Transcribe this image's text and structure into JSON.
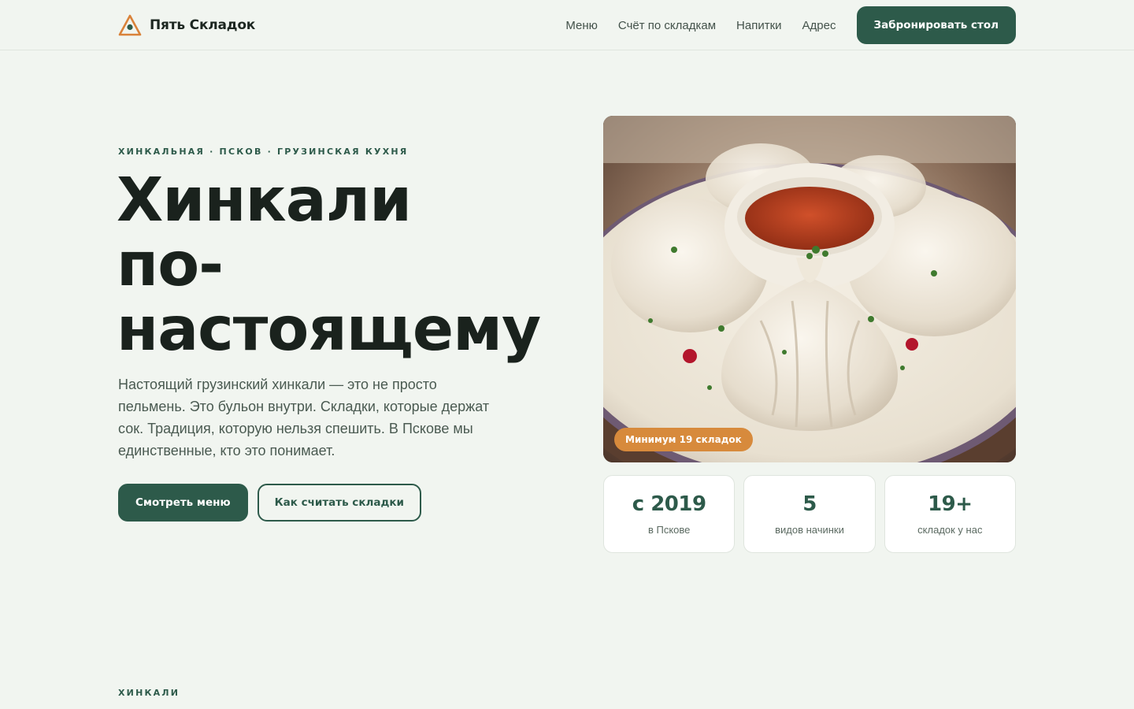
{
  "header": {
    "brand": "Пять Складок",
    "nav": [
      {
        "label": "Меню"
      },
      {
        "label": "Счёт по складкам"
      },
      {
        "label": "Напитки"
      },
      {
        "label": "Адрес"
      }
    ],
    "cta_label": "Забронировать стол"
  },
  "hero": {
    "eyebrow": "ХИНКАЛЬНАЯ · ПСКОВ · ГРУЗИНСКАЯ КУХНЯ",
    "title_lines": [
      "Хинкали",
      "по-",
      "настоящему"
    ],
    "lead": "Настоящий грузинский хинкали — это не просто пельмень. Это бульон внутри. Складки, которые держат сок. Традиция, которую нельзя спешить. В Пскове мы единственные, кто это понимает.",
    "primary_button": "Смотреть меню",
    "secondary_button": "Как считать складки",
    "image_badge": "Минимум 19 складок"
  },
  "stats": [
    {
      "value": "с 2019",
      "label": "в Пскове"
    },
    {
      "value": "5",
      "label": "видов начинки"
    },
    {
      "value": "19+",
      "label": "складок у нас"
    }
  ],
  "next_section": {
    "eyebrow": "ХИНКАЛИ"
  },
  "colors": {
    "background": "#f1f5f0",
    "primary": "#2d5a4a",
    "accent": "#d78a3c",
    "logo_accent": "#d9823a"
  },
  "icons": {
    "logo": "triangle-eye-logo-icon"
  }
}
